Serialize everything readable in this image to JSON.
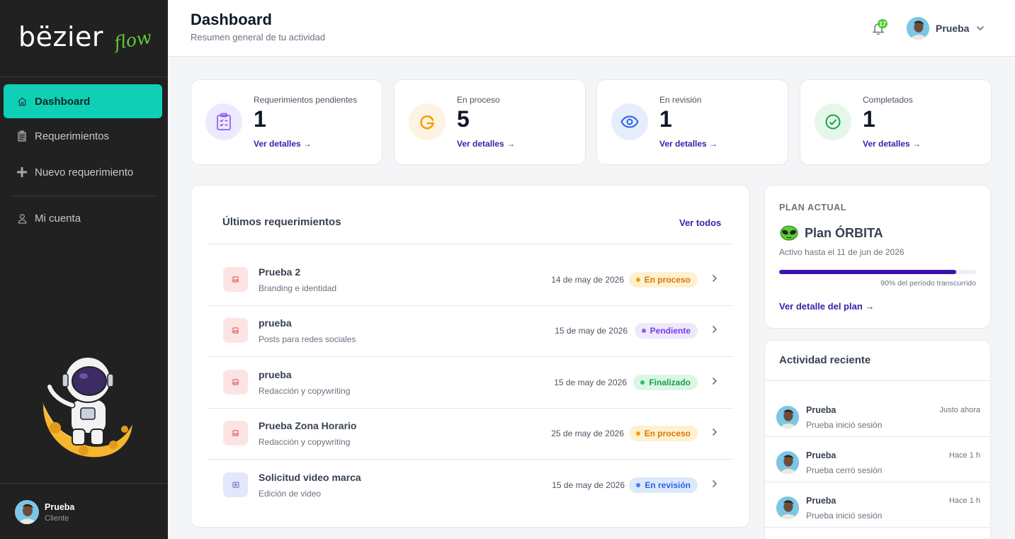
{
  "brand": {
    "name": "bëzier",
    "tagline": "flow"
  },
  "sidebar": {
    "items": [
      {
        "label": "Dashboard",
        "icon": "home-icon",
        "active": true
      },
      {
        "label": "Requerimientos",
        "icon": "clipboard-icon",
        "active": false
      },
      {
        "label": "Nuevo requerimiento",
        "icon": "plus-icon",
        "active": false
      },
      {
        "label": "Mi cuenta",
        "icon": "user-icon",
        "active": false
      }
    ],
    "user": {
      "name": "Prueba",
      "role": "Cliente"
    }
  },
  "header": {
    "title": "Dashboard",
    "subtitle": "Resumen general de tu actividad",
    "notifications": "17",
    "user_name": "Prueba"
  },
  "stats": [
    {
      "label": "Requerimientos pendientes",
      "value": "1",
      "link": "Ver detalles →",
      "icon": "clipboard-list-icon",
      "color": "#8b5cf6"
    },
    {
      "label": "En proceso",
      "value": "5",
      "link": "Ver detalles →",
      "icon": "refresh-icon",
      "color": "#f59e0b"
    },
    {
      "label": "En revisión",
      "value": "1",
      "link": "Ver detalles →",
      "icon": "eye-icon",
      "color": "#2563eb"
    },
    {
      "label": "Completados",
      "value": "1",
      "link": "Ver detalles →",
      "icon": "check-circle-icon",
      "color": "#16a34a"
    }
  ],
  "requirements": {
    "title": "Últimos requerimientos",
    "view_all": "Ver todos",
    "rows": [
      {
        "name": "Prueba 2",
        "category": "Branding e identidad",
        "date": "14 de may de 2026",
        "status": "En proceso",
        "status_color": "#d97706",
        "status_bg": "#fdf1cf",
        "icon": "image-icon",
        "icon_color": "#e05a5a",
        "icon_bg": "#fde4e4"
      },
      {
        "name": "prueba",
        "category": "Posts para redes sociales",
        "date": "15 de may de 2026",
        "status": "Pendiente",
        "status_color": "#7c3aed",
        "status_bg": "#ede9fb",
        "icon": "image-icon",
        "icon_color": "#e05a5a",
        "icon_bg": "#fde4e4"
      },
      {
        "name": "prueba",
        "category": "Redacción y copywriting",
        "date": "15 de may de 2026",
        "status": "Finalizado",
        "status_color": "#16a34a",
        "status_bg": "#dcf6e4",
        "icon": "image-icon",
        "icon_color": "#e05a5a",
        "icon_bg": "#fde4e4"
      },
      {
        "name": "Prueba Zona Horario",
        "category": "Redacción y copywriting",
        "date": "25 de may de 2026",
        "status": "En proceso",
        "status_color": "#d97706",
        "status_bg": "#fdf1cf",
        "icon": "image-icon",
        "icon_color": "#e05a5a",
        "icon_bg": "#fde4e4"
      },
      {
        "name": "Solicitud video marca",
        "category": "Edición de video",
        "date": "15 de may de 2026",
        "status": "En revisión",
        "status_color": "#2563eb",
        "status_bg": "#dde9fb",
        "icon": "video-icon",
        "icon_color": "#7b7bd9",
        "icon_bg": "#e4e6fb"
      }
    ]
  },
  "plan": {
    "eyebrow": "PLAN ACTUAL",
    "name": "Plan ÓRBITA",
    "active_until": "Activo hasta el 11 de jun de 2026",
    "progress": 0.9,
    "progress_label": "90% del período transcurrido",
    "link": "Ver detalle del plan →"
  },
  "activity": {
    "title": "Actividad reciente",
    "items": [
      {
        "name": "Prueba",
        "time": "Justo ahora",
        "desc": "Prueba inició sesión"
      },
      {
        "name": "Prueba",
        "time": "Hace 1 h",
        "desc": "Prueba cerró sesión"
      },
      {
        "name": "Prueba",
        "time": "Hace 1 h",
        "desc": "Prueba inició sesión"
      }
    ]
  },
  "colors": {
    "accent": "#0fd0b6",
    "link": "#3b1fa8",
    "sidebar_bg": "#212121"
  }
}
